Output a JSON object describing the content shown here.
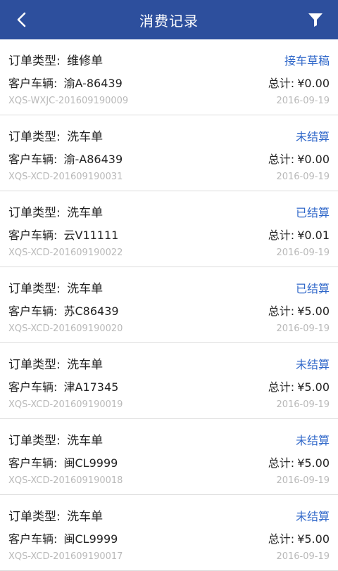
{
  "header": {
    "title": "消费记录"
  },
  "orders": [
    {
      "type_label": "订单类型:",
      "type": "维修单",
      "status": "接车草稿",
      "vehicle_label": "客户车辆:",
      "vehicle": "渝A-86439",
      "total_label": "总计:",
      "total": "¥0.00",
      "order_no": "XQS-WXJC-201609190009",
      "date": "2016-09-19"
    },
    {
      "type_label": "订单类型:",
      "type": "洗车单",
      "status": "未结算",
      "vehicle_label": "客户车辆:",
      "vehicle": "渝-A86439",
      "total_label": "总计:",
      "total": "¥0.00",
      "order_no": "XQS-XCD-201609190031",
      "date": "2016-09-19"
    },
    {
      "type_label": "订单类型:",
      "type": "洗车单",
      "status": "已结算",
      "vehicle_label": "客户车辆:",
      "vehicle": "云V11111",
      "total_label": "总计:",
      "total": "¥0.01",
      "order_no": "XQS-XCD-201609190022",
      "date": "2016-09-19"
    },
    {
      "type_label": "订单类型:",
      "type": "洗车单",
      "status": "已结算",
      "vehicle_label": "客户车辆:",
      "vehicle": "苏C86439",
      "total_label": "总计:",
      "total": "¥5.00",
      "order_no": "XQS-XCD-201609190020",
      "date": "2016-09-19"
    },
    {
      "type_label": "订单类型:",
      "type": "洗车单",
      "status": "未结算",
      "vehicle_label": "客户车辆:",
      "vehicle": "津A17345",
      "total_label": "总计:",
      "total": "¥5.00",
      "order_no": "XQS-XCD-201609190019",
      "date": "2016-09-19"
    },
    {
      "type_label": "订单类型:",
      "type": "洗车单",
      "status": "未结算",
      "vehicle_label": "客户车辆:",
      "vehicle": "闽CL9999",
      "total_label": "总计:",
      "total": "¥5.00",
      "order_no": "XQS-XCD-201609190018",
      "date": "2016-09-19"
    },
    {
      "type_label": "订单类型:",
      "type": "洗车单",
      "status": "未结算",
      "vehicle_label": "客户车辆:",
      "vehicle": "闽CL9999",
      "total_label": "总计:",
      "total": "¥5.00",
      "order_no": "XQS-XCD-201609190017",
      "date": "2016-09-19"
    }
  ],
  "icons": {
    "back": "back-arrow-icon",
    "filter": "filter-funnel-icon"
  },
  "colors": {
    "header_bg": "#2d4f9d",
    "status_text": "#2f67c9",
    "muted_text": "#b9b9b9"
  }
}
